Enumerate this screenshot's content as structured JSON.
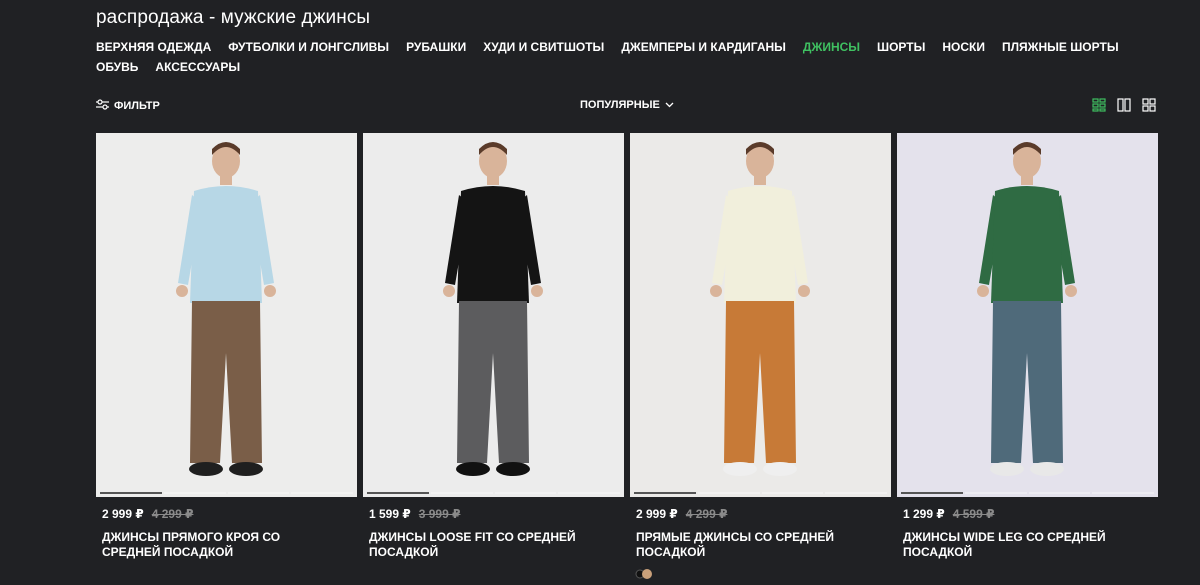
{
  "page": {
    "title": "распродажа - мужские джинсы"
  },
  "categories": [
    {
      "label": "ВЕРХНЯЯ ОДЕЖДА",
      "active": false
    },
    {
      "label": "ФУТБОЛКИ И ЛОНГСЛИВЫ",
      "active": false
    },
    {
      "label": "РУБАШКИ",
      "active": false
    },
    {
      "label": "ХУДИ И СВИТШОТЫ",
      "active": false
    },
    {
      "label": "ДЖЕМПЕРЫ И КАРДИГАНЫ",
      "active": false
    },
    {
      "label": "ДЖИНСЫ",
      "active": true
    },
    {
      "label": "ШОРТЫ",
      "active": false
    },
    {
      "label": "НОСКИ",
      "active": false
    },
    {
      "label": "ПЛЯЖНЫЕ ШОРТЫ",
      "active": false
    },
    {
      "label": "ОБУВЬ",
      "active": false
    },
    {
      "label": "АКСЕССУАРЫ",
      "active": false
    }
  ],
  "toolbar": {
    "filter_label": "ФИЛЬТР",
    "sort_label": "ПОПУЛЯРНЫЕ",
    "view_modes": [
      "grid-4-icon",
      "grid-2-icon",
      "grid-small-icon"
    ],
    "active_view": 0
  },
  "colors": {
    "background": "#202124",
    "accent_green": "#3fc061",
    "old_price": "#8a8a8a"
  },
  "products": [
    {
      "price": "2 999 ₽",
      "old_price": "4 299 ₽",
      "name": "ДЖИНСЫ ПРЯМОГО КРОЯ СО СРЕДНЕЙ ПОСАДКОЙ",
      "photo_bg": "#ededec",
      "top_color": "#b7d7e6",
      "pants_color": "#7a5e48",
      "shoe_color": "#1f1f1f",
      "slides": 4,
      "active_slide": 0
    },
    {
      "price": "1 599 ₽",
      "old_price": "3 999 ₽",
      "name": "ДЖИНСЫ LOOSE FIT СО СРЕДНЕЙ ПОСАДКОЙ",
      "photo_bg": "#ececec",
      "top_color": "#141414",
      "pants_color": "#5c5c5e",
      "shoe_color": "#111111",
      "slides": 4,
      "active_slide": 0
    },
    {
      "price": "2 999 ₽",
      "old_price": "4 299 ₽",
      "name": "ПРЯМЫЕ ДЖИНСЫ СО СРЕДНЕЙ ПОСАДКОЙ",
      "photo_bg": "#ebeae8",
      "top_color": "#f1efdc",
      "pants_color": "#c77a37",
      "shoe_color": "#efefef",
      "slides": 4,
      "active_slide": 0
    },
    {
      "price": "1 299 ₽",
      "old_price": "4 599 ₽",
      "name": "ДЖИНСЫ WIDE LEG СО СРЕДНЕЙ ПОСАДКОЙ",
      "photo_bg": "#e4e2ec",
      "top_color": "#2f6b43",
      "pants_color": "#4f6a7a",
      "shoe_color": "#e8e8e8",
      "slides": 4,
      "active_slide": 0
    }
  ],
  "pager": {
    "dots": 2,
    "active": 1,
    "active_color": "#c9a07a"
  }
}
